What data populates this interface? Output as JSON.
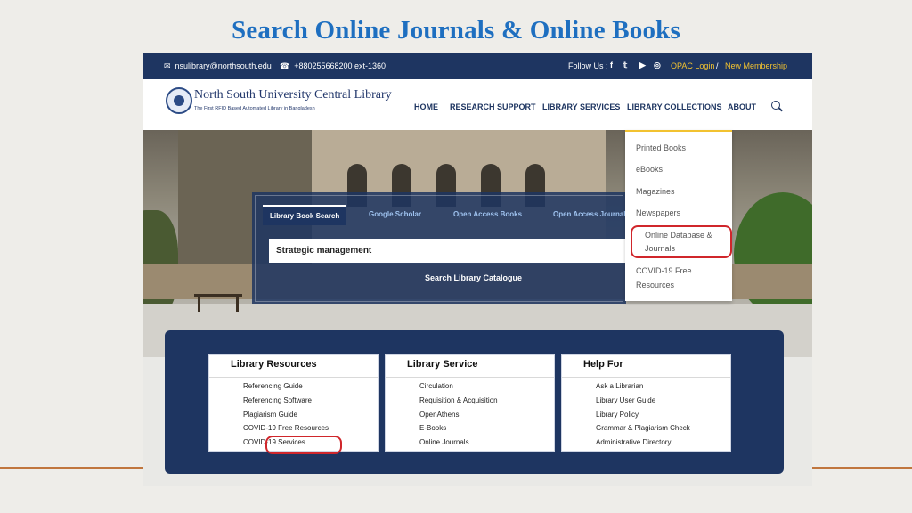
{
  "slide": {
    "title": "Search Online Journals & Online Books"
  },
  "topbar": {
    "email": "nsulibrary@northsouth.edu",
    "phone": "+880255668200 ext-1360",
    "follow": "Follow Us :",
    "social_icons": [
      "facebook-icon",
      "twitter-icon",
      "youtube-icon",
      "instagram-icon"
    ],
    "opac": "OPAC Login",
    "divider": "/",
    "membership": "New Membership",
    "bg": "#1e3561",
    "accent": "#f2c230"
  },
  "header": {
    "name": "North South University Central Library",
    "tagline": "The First RFID Based Automated Library in Bangladesh",
    "nav": [
      "HOME",
      "RESEARCH SUPPORT",
      "LIBRARY SERVICES",
      "LIBRARY COLLECTIONS",
      "ABOUT"
    ]
  },
  "search": {
    "tabs": [
      "Library Book Search",
      "Google Scholar",
      "Open Access Books",
      "Open Access Journals"
    ],
    "active_tab": "Library Book Search",
    "query": "Strategic management",
    "button": "Search Library Catalogue"
  },
  "dropdown": {
    "items": [
      "Printed Books",
      "eBooks",
      "Magazines",
      "Newspapers",
      "Online Database &",
      "Journals",
      "COVID-19 Free",
      "Resources"
    ]
  },
  "cards": [
    {
      "title": "Library Resources",
      "items": [
        "Referencing Guide",
        "Referencing Software",
        "Plagiarism Guide",
        "COVID-19 Free Resources",
        "COVID-19 Services"
      ]
    },
    {
      "title": "Library Service",
      "items": [
        "Circulation",
        "Requisition & Acquisition",
        "OpenAthens",
        "E-Books",
        "Online Journals"
      ]
    },
    {
      "title": "Help For",
      "items": [
        "Ask a Librarian",
        "Library User Guide",
        "Library Policy",
        "Grammar & Plagiarism Check",
        "Administrative Directory"
      ]
    }
  ],
  "highlight_color": "#d0262b"
}
